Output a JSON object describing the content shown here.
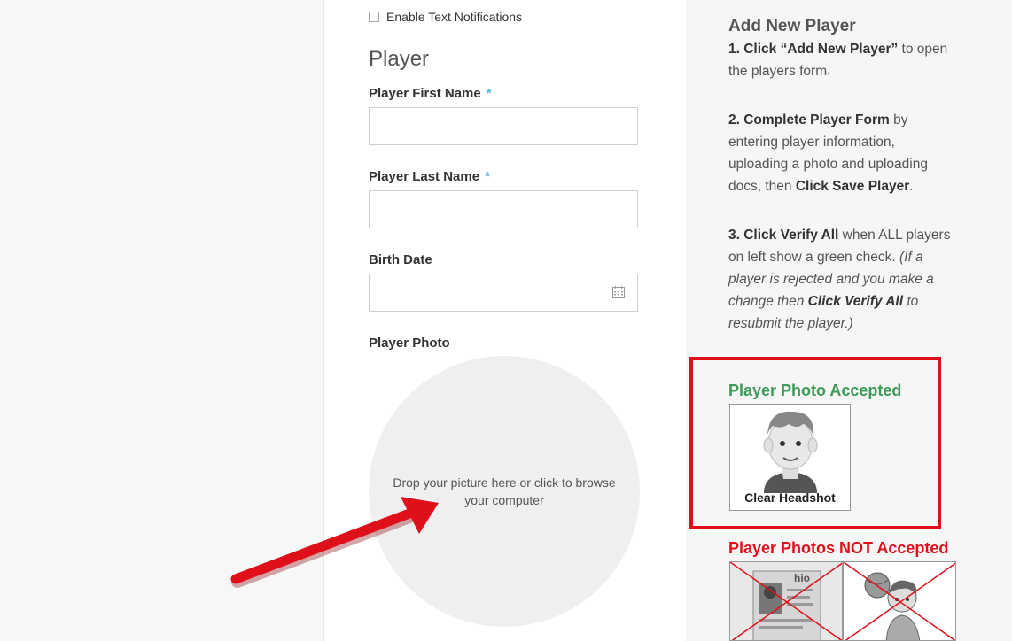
{
  "form": {
    "text_notifications_label": "Enable Text Notifications",
    "section_title": "Player",
    "first_name": {
      "label": "Player First Name",
      "required_mark": "*",
      "value": ""
    },
    "last_name": {
      "label": "Player Last Name",
      "required_mark": "*",
      "value": ""
    },
    "birth_date": {
      "label": "Birth Date",
      "value": "",
      "icon": "calendar-icon"
    },
    "photo": {
      "label": "Player Photo",
      "dropzone_text": "Drop your picture here or click to browse your computer"
    }
  },
  "help": {
    "title": "Add New Player",
    "step1_bold": "1. Click “Add New Player”",
    "step1_rest": " to open the players form.",
    "step2_bold": "2. Complete Player Form",
    "step2_rest": " by entering player information, uploading a photo and uploading docs, then ",
    "step2_bold2": "Click Save Player",
    "step2_end": ".",
    "step3_bold": "3. Click Verify All",
    "step3_rest": " when ALL players on left show a green check. ",
    "step3_italic1": "(If a player is rejected and you make a change then ",
    "step3_italic_bold": "Click Verify All",
    "step3_italic2": " to resubmit the player.)",
    "accepted_title": "Player Photo Accepted",
    "headshot_caption": "Clear Headshot",
    "rejected_title": "Player Photos NOT Accepted",
    "id_card_text": "hio"
  },
  "colors": {
    "accepted": "#3f9a5a",
    "rejected": "#e0101a",
    "required": "#4db6e8",
    "annotation_arrow": "#e0101a"
  }
}
